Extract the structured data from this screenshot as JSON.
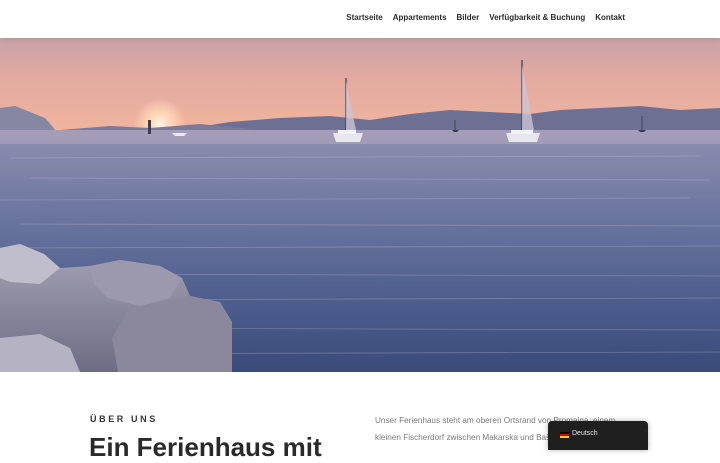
{
  "nav": {
    "items": [
      {
        "label": "Startseite"
      },
      {
        "label": "Appartements"
      },
      {
        "label": "Bilder"
      },
      {
        "label": "Verfügbarkeit & Buchung"
      },
      {
        "label": "Kontakt"
      }
    ]
  },
  "hero": {
    "image": "sunset-sea-sailboats"
  },
  "about": {
    "eyebrow": "ÜBER UNS",
    "headline": "Ein Ferienhaus mit",
    "intro_line1": "Unser Ferienhaus steht am oberen Ortsrand von Promajna, einem",
    "intro_line2": "kleinen Fischerdorf zwischen Makarska und Baška Voda"
  },
  "language_switcher": {
    "label": "Deutsch",
    "flag_colors": [
      "#000000",
      "#dd0000",
      "#ffce00"
    ]
  }
}
